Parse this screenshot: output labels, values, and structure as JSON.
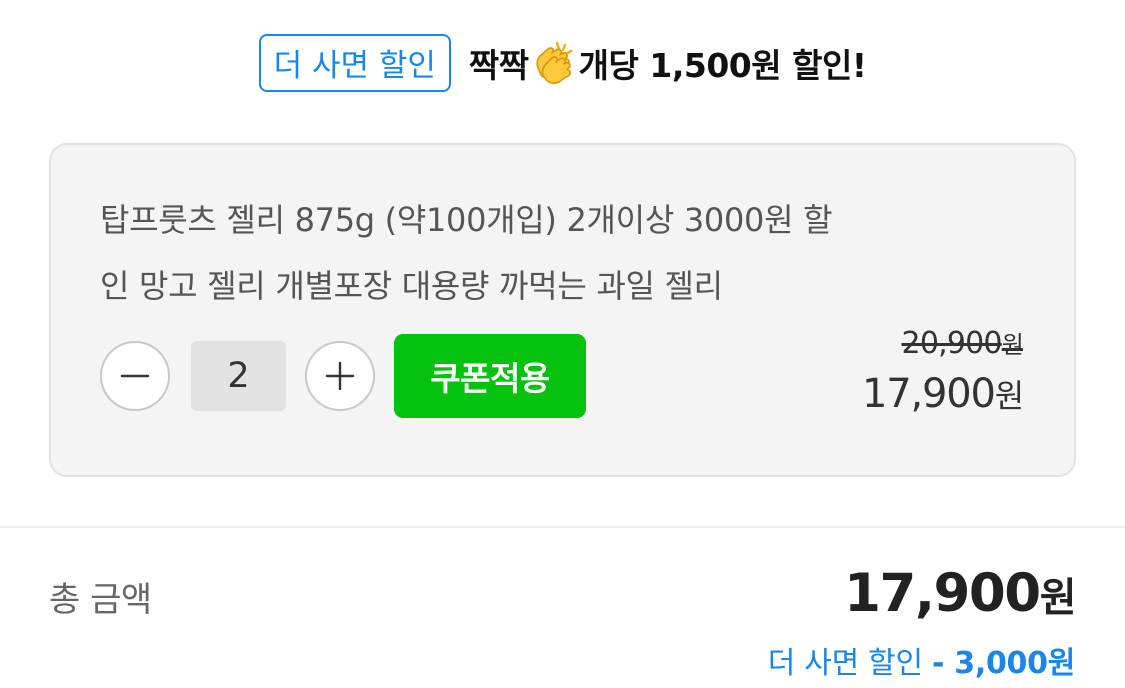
{
  "promo": {
    "badge": "더 사면 할인",
    "text_before_icon": "짝짝",
    "icon": "clapping-hands-icon",
    "text_after_icon": "개당 1,500원 할인!"
  },
  "product": {
    "name_line1": "탑프룻츠 젤리 875g (약100개입) 2개이상 3000원 할",
    "name_line2": "인 망고 젤리 개별포장 대용량 까먹는 과일 젤리",
    "quantity": "2",
    "decrease_icon": "minus-icon",
    "increase_icon": "plus-icon",
    "coupon_label": "쿠폰적용",
    "original_price": "20,900",
    "current_price": "17,900",
    "currency_unit": "원"
  },
  "total": {
    "label": "총 금액",
    "amount": "17,900",
    "unit": "원",
    "discount_label": "더 사면 할인",
    "discount_amount": "- 3,000원"
  },
  "colors": {
    "accent_blue": "#1a86e8",
    "coupon_green": "#05c20f",
    "card_background": "#f4f4f4"
  }
}
